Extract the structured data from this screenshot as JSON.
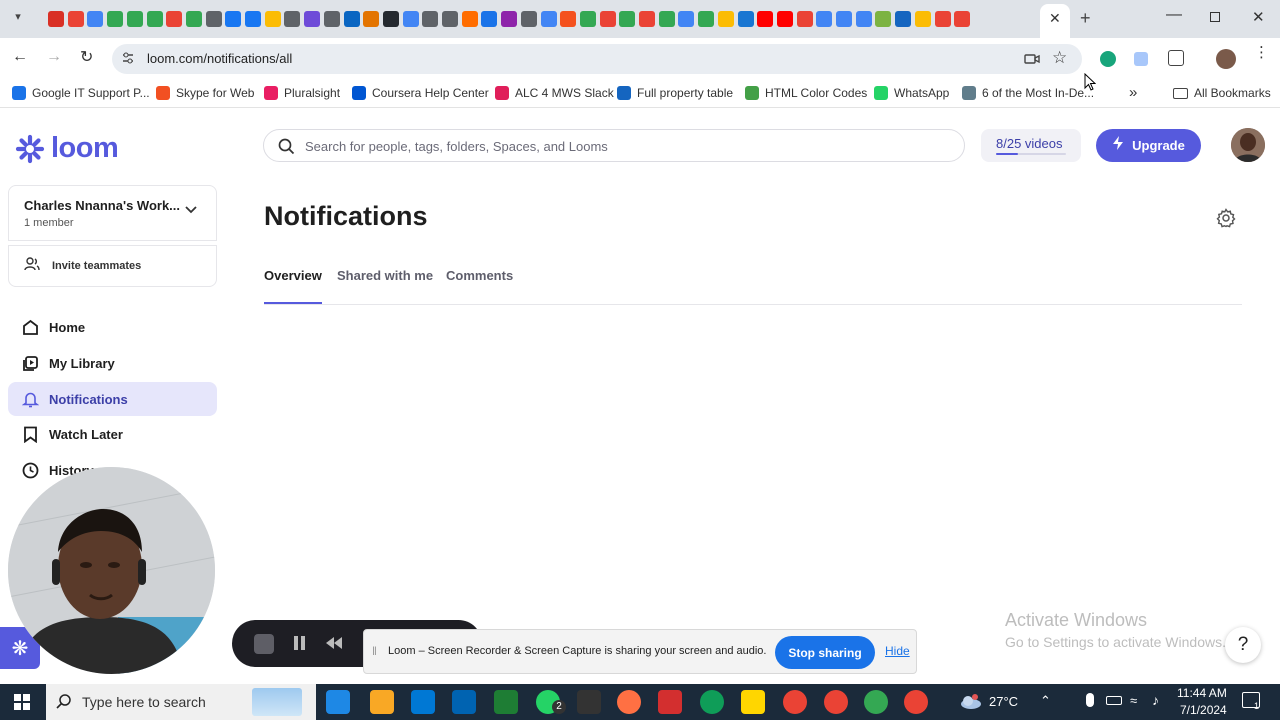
{
  "browser": {
    "url": "loom.com/notifications/all",
    "tab_icon_colors": [
      "#d93025",
      "#ea4335",
      "#4285f4",
      "#34a853",
      "#34a853",
      "#34a853",
      "#ea4335",
      "#34a853",
      "#5f6368",
      "#1877f2",
      "#1877f2",
      "#fbbc04",
      "#5f6368",
      "#6e4bd8",
      "#5f6368",
      "#0a66c2",
      "#e37400",
      "#24292f",
      "#4285f4",
      "#5f6368",
      "#5f6368",
      "#ff6d00",
      "#1a73e8",
      "#8e24aa",
      "#5f6368",
      "#4285f4",
      "#f4511e",
      "#34a853",
      "#ea4335",
      "#34a853",
      "#ea4335",
      "#34a853",
      "#4285f4",
      "#34a853",
      "#fbbc04",
      "#1976d2",
      "#ff0000",
      "#ff0000",
      "#ea4335",
      "#4285f4",
      "#4285f4",
      "#4285f4",
      "#7cb342",
      "#1565c0",
      "#fbbc04",
      "#ea4335",
      "#ea4335"
    ],
    "bookmarks": [
      {
        "label": "Google IT Support P...",
        "color": "#1a73e8"
      },
      {
        "label": "Skype for Web",
        "color": "#f25022"
      },
      {
        "label": "Pluralsight",
        "color": "#e91e63"
      },
      {
        "label": "Coursera Help Center",
        "color": "#0056d2"
      },
      {
        "label": "ALC 4 MWS Slack",
        "color": "#e01e5a"
      },
      {
        "label": "Full property table",
        "color": "#1565c0"
      },
      {
        "label": "HTML Color Codes",
        "color": "#43a047"
      },
      {
        "label": "WhatsApp",
        "color": "#25d366"
      },
      {
        "label": "6 of the Most In-De...",
        "color": "#607d8b"
      }
    ],
    "all_bookmarks_label": "All Bookmarks"
  },
  "app": {
    "logo_text": "loom",
    "brand_color": "#565add",
    "workspace": {
      "name": "Charles Nnanna's Work...",
      "members": "1 member"
    },
    "invite_label": "Invite teammates",
    "nav": [
      {
        "label": "Home",
        "icon": "home-icon"
      },
      {
        "label": "My Library",
        "icon": "library-icon"
      },
      {
        "label": "Notifications",
        "icon": "bell-icon",
        "active": true
      },
      {
        "label": "Watch Later",
        "icon": "bookmark-icon"
      },
      {
        "label": "History",
        "icon": "clock-icon"
      }
    ],
    "search_placeholder": "Search for people, tags, folders, Spaces, and Looms",
    "video_count": "8/25 videos",
    "video_progress": 0.32,
    "upgrade_label": "Upgrade",
    "page_title": "Notifications",
    "tabs": [
      {
        "label": "Overview",
        "active": true
      },
      {
        "label": "Shared with me"
      },
      {
        "label": "Comments"
      }
    ],
    "help_label": "?"
  },
  "share_bar": {
    "message": "Loom – Screen Recorder & Screen Capture is sharing your screen and audio.",
    "stop_label": "Stop sharing",
    "hide_label": "Hide"
  },
  "watermark": {
    "line1": "Activate Windows",
    "line2": "Go to Settings to activate Windows."
  },
  "taskbar": {
    "search_placeholder": "Type here to search",
    "temperature": "27°C",
    "time": "11:44 AM",
    "date": "7/1/2024",
    "notification_count": "1",
    "whatsapp_badge": "2"
  }
}
